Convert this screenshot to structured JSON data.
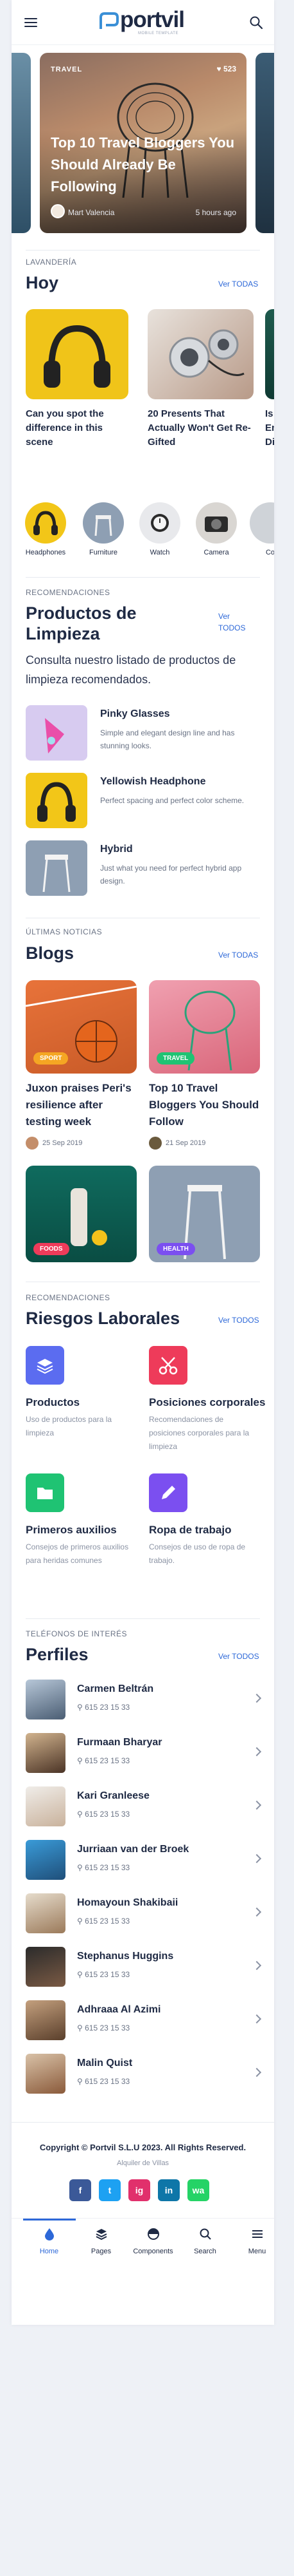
{
  "header": {
    "logo_text": "portvil",
    "logo_sub": "MOBILE TEMPLATE"
  },
  "hero": {
    "category": "TRAVEL",
    "likes": "523",
    "title": "Top 10 Travel Bloggers You Should Already Be Following",
    "author": "Mart Valencia",
    "time": "5 hours ago"
  },
  "today": {
    "label": "LAVANDERÍA",
    "title": "Hoy",
    "see_all": "Ver TODAS",
    "cards": [
      {
        "caption": "Can you spot the difference in this scene"
      },
      {
        "caption": "20 Presents That Actually Won't Get Re-Gifted"
      },
      {
        "caption": "Is O Ene Dise"
      }
    ]
  },
  "categories": [
    {
      "label": "Headphones"
    },
    {
      "label": "Furniture"
    },
    {
      "label": "Watch"
    },
    {
      "label": "Camera"
    },
    {
      "label": "Co"
    }
  ],
  "products": {
    "label": "RECOMENDACIONES",
    "title": "Productos de Limpieza",
    "see_all": "Ver TODOS",
    "intro": "Consulta nuestro listado de productos de limpieza recomendados.",
    "items": [
      {
        "name": "Pinky Glasses",
        "desc": "Simple and elegant design line and has stunning looks."
      },
      {
        "name": "Yellowish Headphone",
        "desc": "Perfect spacing and perfect color scheme."
      },
      {
        "name": "Hybrid",
        "desc": "Just what you need for perfect hybrid app design."
      }
    ]
  },
  "blogs": {
    "label": "ÚLTIMAS NOTICIAS",
    "title": "Blogs",
    "see_all": "Ver TODAS",
    "items": [
      {
        "tag": "SPORT",
        "title": "Juxon praises Peri's resilience after testing week",
        "date": "25 Sep 2019"
      },
      {
        "tag": "TRAVEL",
        "title": "Top 10 Travel Bloggers You Should Follow",
        "date": "21 Sep 2019"
      },
      {
        "tag": "FOODS"
      },
      {
        "tag": "HEALTH"
      }
    ]
  },
  "risks": {
    "label": "RECOMENDACIONES",
    "title": "Riesgos Laborales",
    "see_all": "Ver TODOS",
    "items": [
      {
        "title": "Productos",
        "desc": "Uso de productos para la limpieza"
      },
      {
        "title": "Posiciones corporales",
        "desc": "Recomendaciones de posiciones corporales para la limpieza"
      },
      {
        "title": "Primeros auxilios",
        "desc": "Consejos de primeros auxilios para heridas comunes"
      },
      {
        "title": "Ropa de trabajo",
        "desc": "Consejos de uso de ropa de trabajo."
      }
    ]
  },
  "profiles": {
    "label": "TELÉFONOS DE INTERÉS",
    "title": "Perfiles",
    "see_all": "Ver TODOS",
    "items": [
      {
        "name": "Carmen Beltrán",
        "phone": "615 23 15 33"
      },
      {
        "name": "Furmaan Bharyar",
        "phone": "615 23 15 33"
      },
      {
        "name": "Kari Granleese",
        "phone": "615 23 15 33"
      },
      {
        "name": "Jurriaan van der Broek",
        "phone": "615 23 15 33"
      },
      {
        "name": "Homayoun Shakibaii",
        "phone": "615 23 15 33"
      },
      {
        "name": "Stephanus Huggins",
        "phone": "615 23 15 33"
      },
      {
        "name": "Adhraaa Al Azimi",
        "phone": "615 23 15 33"
      },
      {
        "name": "Malin Quist",
        "phone": "615 23 15 33"
      }
    ]
  },
  "footer": {
    "copyright": "Copyright © Portvil S.L.U 2023. All Rights Reserved.",
    "sub": "Alquiler de Villas",
    "social": [
      "f",
      "t",
      "ig",
      "in",
      "wa"
    ]
  },
  "nav": [
    {
      "label": "Home"
    },
    {
      "label": "Pages"
    },
    {
      "label": "Components"
    },
    {
      "label": "Search"
    },
    {
      "label": "Menu"
    }
  ],
  "colors": {
    "accent": "#2d68d8",
    "risk_blue": "#5b6cf0",
    "risk_red": "#ee3b5a",
    "risk_green": "#1fc373",
    "risk_purple": "#7b4ff0"
  }
}
